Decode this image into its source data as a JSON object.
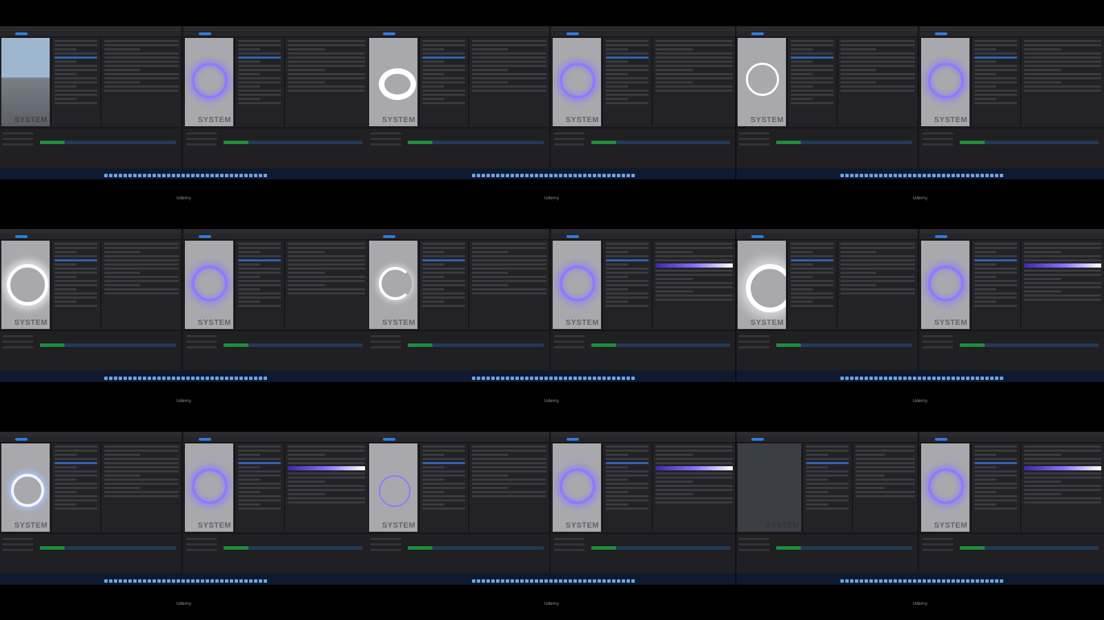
{
  "watermark": "Udemy",
  "viewport_label": "SYSTEM",
  "cells": [
    {
      "left_view": "scene-grid",
      "right_view": "purple-ring"
    },
    {
      "left_view": "white-donut",
      "right_view": "purple-ring"
    },
    {
      "left_view": "white-ring",
      "right_view": "purple-ring"
    },
    {
      "left_view": "white-particle-ring",
      "right_view": "purple-ring"
    },
    {
      "left_view": "swirl-ring",
      "right_view": "purple-ring"
    },
    {
      "left_view": "swirl-large",
      "right_view": "purple-ring"
    },
    {
      "left_view": "white-ring-thin",
      "right_view": "purple-ring"
    },
    {
      "left_view": "purple-thin-ring",
      "right_view": "purple-ring"
    },
    {
      "left_view": "scene-3d",
      "right_view": "purple-ring"
    }
  ],
  "colors": {
    "background": "#000000",
    "editor": "#1f1f22",
    "accent": "#2f7de1",
    "glow": "#8c7bff",
    "timeline_green": "#1d8e3a"
  }
}
